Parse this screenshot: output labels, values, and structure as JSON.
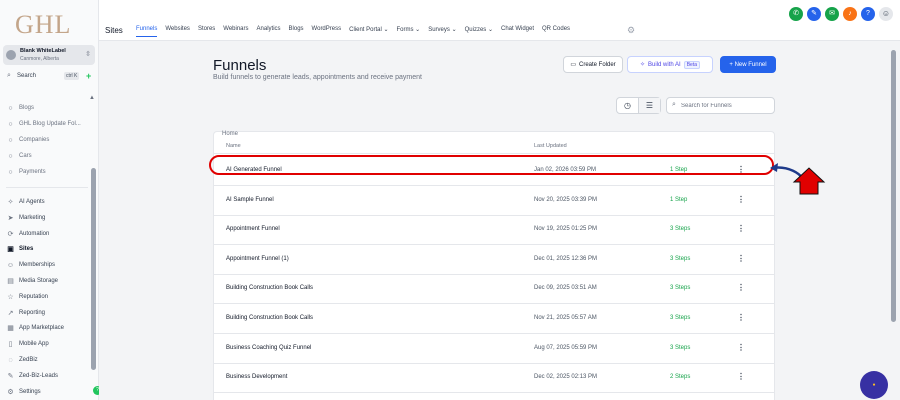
{
  "logo": "GHL",
  "account": {
    "name": "Blank WhiteLabel",
    "location": "Canmore, Alberta"
  },
  "sidebar": {
    "search_label": "Search",
    "search_shortcut": "ctrl K",
    "top_items": [
      {
        "label": "Blogs",
        "icon": "circle-icon"
      },
      {
        "label": "GHL Blog Update Fol...",
        "icon": "circle-icon"
      },
      {
        "label": "Companies",
        "icon": "circle-icon"
      },
      {
        "label": "Cars",
        "icon": "circle-icon"
      },
      {
        "label": "Payments",
        "icon": "circle-icon"
      }
    ],
    "items": [
      {
        "label": "AI Agents",
        "icon": "sparkles-icon"
      },
      {
        "label": "Marketing",
        "icon": "send-icon"
      },
      {
        "label": "Automation",
        "icon": "automation-icon"
      },
      {
        "label": "Sites",
        "icon": "sites-icon",
        "active": true
      },
      {
        "label": "Memberships",
        "icon": "memberships-icon"
      },
      {
        "label": "Media Storage",
        "icon": "media-icon"
      },
      {
        "label": "Reputation",
        "icon": "star-icon"
      },
      {
        "label": "Reporting",
        "icon": "chart-icon"
      },
      {
        "label": "App Marketplace",
        "icon": "grid-icon"
      },
      {
        "label": "Mobile App",
        "icon": "mobile-icon"
      },
      {
        "label": "ZedBiz",
        "icon": "zedbiz-icon"
      },
      {
        "label": "Zed-Biz-Leads",
        "icon": "wrench-icon"
      },
      {
        "label": "Settings",
        "icon": "gear-icon"
      }
    ]
  },
  "header": {
    "section": "Sites",
    "tabs": [
      "Funnels",
      "Websites",
      "Stores",
      "Webinars",
      "Analytics",
      "Blogs",
      "WordPress",
      "Client Portal",
      "Forms",
      "Surveys",
      "Quizzes",
      "Chat Widget",
      "QR Codes"
    ],
    "tabs_with_dropdown": [
      "Client Portal",
      "Forms",
      "Surveys",
      "Quizzes"
    ],
    "active_tab": "Funnels"
  },
  "page": {
    "title": "Funnels",
    "subtitle": "Build funnels to generate leads, appointments and receive payment",
    "create_folder": "Create Folder",
    "build_ai": "Build with AI",
    "beta": "Beta",
    "new_funnel": "+ New Funnel",
    "search_placeholder": "Search for Funnels",
    "breadcrumb": "Home"
  },
  "table": {
    "columns": [
      "Name",
      "Last Updated"
    ],
    "rows": [
      {
        "name": "AI Generated Funnel",
        "updated": "Jan 02, 2026 03:59 PM",
        "steps": "1 Step"
      },
      {
        "name": "AI Sample Funnel",
        "updated": "Nov 20, 2025 03:39 PM",
        "steps": "1 Step"
      },
      {
        "name": "Appointment Funnel",
        "updated": "Nov 19, 2025 01:25 PM",
        "steps": "3 Steps"
      },
      {
        "name": "Appointment Funnel (1)",
        "updated": "Dec 01, 2025 12:36 PM",
        "steps": "3 Steps"
      },
      {
        "name": "Building Construction Book Calls",
        "updated": "Dec 09, 2025 03:51 AM",
        "steps": "3 Steps"
      },
      {
        "name": "Building Construction Book Calls",
        "updated": "Nov 21, 2025 05:57 AM",
        "steps": "3 Steps"
      },
      {
        "name": "Business Coaching Quiz Funnel",
        "updated": "Aug 07, 2025 05:59 PM",
        "steps": "3 Steps"
      },
      {
        "name": "Business Development",
        "updated": "Dec 02, 2025 02:13 PM",
        "steps": "2 Steps"
      }
    ]
  },
  "colors": {
    "accent": "#2563eb",
    "steps": "#16a34a",
    "annotation": "#e00000"
  }
}
